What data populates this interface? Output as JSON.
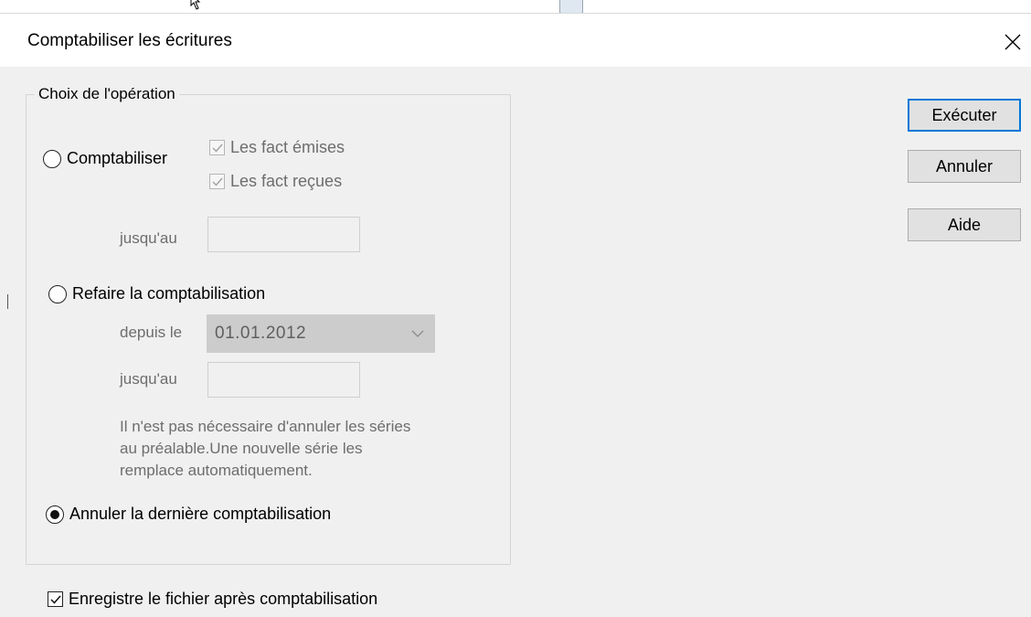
{
  "dialog": {
    "title": "Comptabiliser les écritures"
  },
  "group": {
    "legend": "Choix de l'opération"
  },
  "options": {
    "comptabiliser": {
      "label": "Comptabiliser",
      "selected": false,
      "fact_emises_label": "Les fact émises",
      "fact_emises_checked": true,
      "fact_recues_label": "Les fact reçues",
      "fact_recues_checked": true,
      "jusquau_label": "jusqu'au",
      "jusquau_value": ""
    },
    "refaire": {
      "label": "Refaire la comptabilisation",
      "selected": false,
      "depuis_label": "depuis le",
      "depuis_value": "01.01.2012",
      "jusquau_label": "jusqu'au",
      "jusquau_value": "",
      "note_line1": "Il n'est pas nécessaire d'annuler les séries",
      "note_line2": "au préalable.Une nouvelle série les",
      "note_line3": "remplace automatiquement."
    },
    "annuler": {
      "label": "Annuler la dernière comptabilisation",
      "selected": true
    }
  },
  "save_after": {
    "label": "Enregistre le fichier après comptabilisation",
    "checked": true
  },
  "buttons": {
    "executer": "Exécuter",
    "annuler": "Annuler",
    "aide": "Aide"
  },
  "icons": {
    "close": "close-icon",
    "cursor": "mouse-cursor-icon",
    "dropdown": "chevron-down-icon",
    "check": "checkmark-icon"
  },
  "colors": {
    "accent": "#0078d7",
    "dialog_bg": "#f0f0f0",
    "disabled_text": "#6d6d6d"
  }
}
